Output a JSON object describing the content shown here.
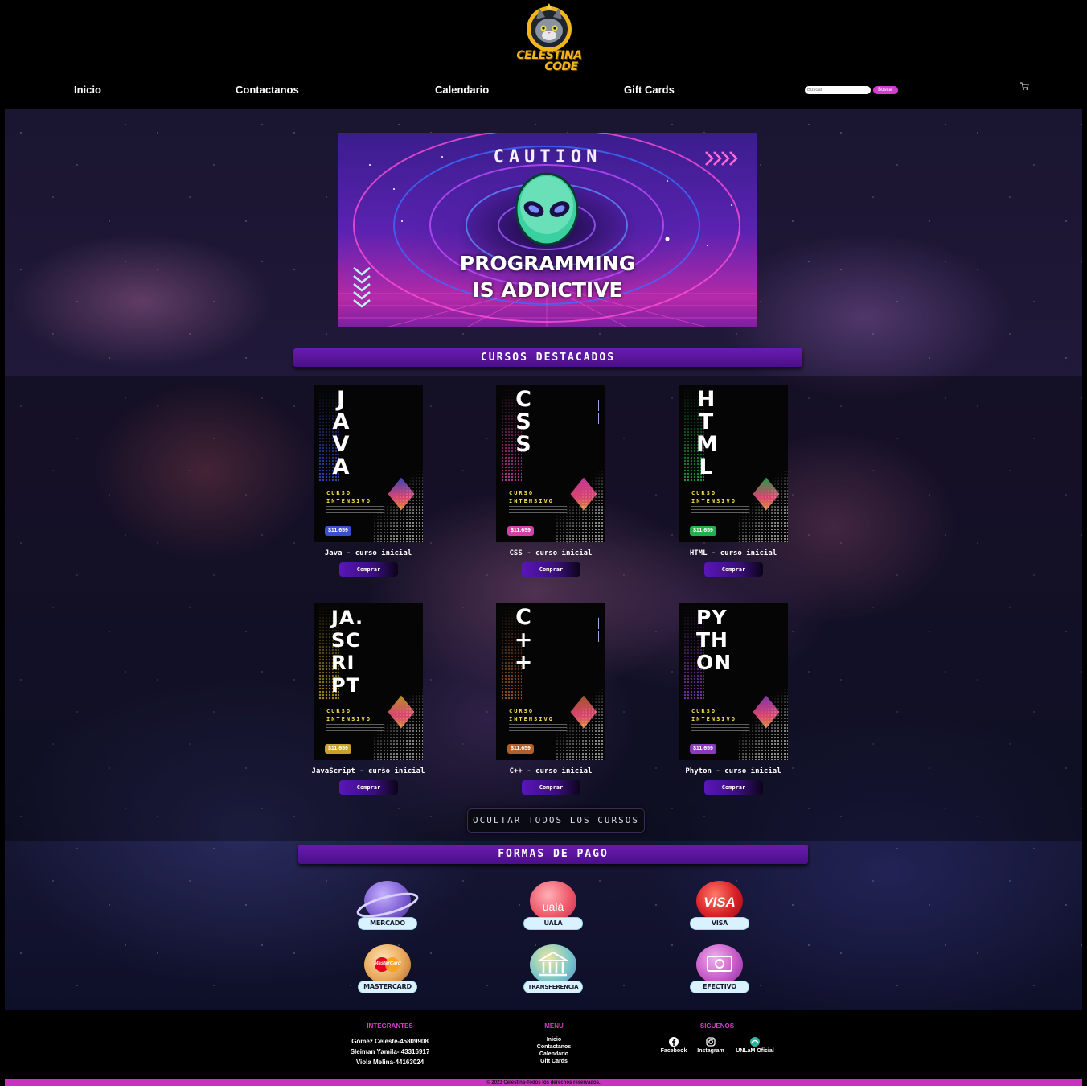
{
  "header": {
    "logo_line1": "CELESTINA",
    "logo_line2": "CODE",
    "nav": [
      "Inicio",
      "Contactanos",
      "Calendario",
      "Gift Cards"
    ],
    "search_placeholder": "Buscar",
    "search_button": "Buscar",
    "cart_icon": "cart-icon"
  },
  "hero": {
    "caution": "CAUTION",
    "line1": "PROGRAMMING",
    "line2": "IS ADDICTIVE"
  },
  "featured_title": "CURSOS DESTACADOS",
  "courses": [
    {
      "poster": "JAVA",
      "title": "Java - curso inicial",
      "price": "$11.659",
      "buy": "Comprar",
      "accent": "#3a4fd0"
    },
    {
      "poster": "CSS",
      "title": "CSS - curso inicial",
      "price": "$11.659",
      "buy": "Comprar",
      "accent": "#d43fa8"
    },
    {
      "poster": "HTML",
      "title": "HTML - curso inicial",
      "price": "$11.659",
      "buy": "Comprar",
      "accent": "#22b04a"
    },
    {
      "poster": "JA.SCRIPT",
      "title": "JavaScript - curso inicial",
      "price": "$11.659",
      "buy": "Comprar",
      "accent": "#c9a22a"
    },
    {
      "poster": "C++",
      "title": "C++ - curso inicial",
      "price": "$11.659",
      "buy": "Comprar",
      "accent": "#b0602a"
    },
    {
      "poster": "PYTHON",
      "title": "Phyton - curso inicial",
      "price": "$11.659",
      "buy": "Comprar",
      "accent": "#8a3ac0"
    }
  ],
  "poster_common": {
    "line1": "CURSO",
    "line2": "INTENSIVO"
  },
  "hide_button": "OCULTAR TODOS LOS CURSOS",
  "payment_title": "FORMAS DE PAGO",
  "payments": [
    {
      "label": "MERCADO",
      "orb": "",
      "color": "#9a7ad8"
    },
    {
      "label": "UALA",
      "orb": "ualá",
      "color": "#ef5a6a"
    },
    {
      "label": "VISA",
      "orb": "VISA",
      "color": "#d81f26"
    },
    {
      "label": "MASTERCARD",
      "orb": "MasterCard",
      "color": "#e8a85a"
    },
    {
      "label": "TRANSFERENCIA",
      "orb": "",
      "color": "#7ac8c8"
    },
    {
      "label": "EFECTIVO",
      "orb": "",
      "color": "#c85ac8"
    }
  ],
  "footer": {
    "integrantes_title": "INTEGRANTES",
    "integrantes": [
      "Gómez Celeste-45809908",
      "Sleiman Yamila- 43316917",
      "Viola Melina-44163024"
    ],
    "menu_title": "MENU",
    "menu": [
      "Inicio",
      "Contactanos",
      "Calendario",
      "Gift Cards"
    ],
    "siguenos_title": "SIGUENOS",
    "social": [
      "Facebook",
      "Instagram",
      "UNLaM Oficial"
    ],
    "copyright": "© 2023 Celestina-Todos los derechos reservados."
  }
}
